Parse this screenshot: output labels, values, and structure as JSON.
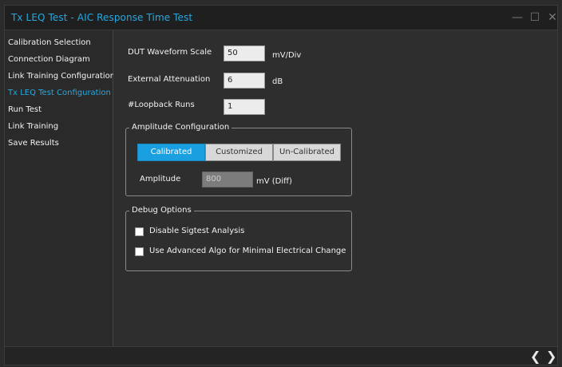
{
  "window": {
    "title": "Tx LEQ Test - AIC Response Time Test",
    "minimize_glyph": "—",
    "maximize_glyph": "☐",
    "close_glyph": "✕"
  },
  "sidebar": {
    "items": [
      {
        "label": "Calibration Selection",
        "active": false
      },
      {
        "label": "Connection Diagram",
        "active": false
      },
      {
        "label": "Link Training Configuration",
        "active": false
      },
      {
        "label": "Tx LEQ Test Configuration",
        "active": true
      },
      {
        "label": "Run Test",
        "active": false
      },
      {
        "label": "Link Training",
        "active": false
      },
      {
        "label": "Save Results",
        "active": false
      }
    ]
  },
  "form": {
    "dut_waveform_scale": {
      "label": "DUT Waveform Scale",
      "value": "50",
      "unit": "mV/Div"
    },
    "external_attenuation": {
      "label": "External Attenuation",
      "value": "6",
      "unit": "dB"
    },
    "loopback_runs": {
      "label": "#Loopback Runs",
      "value": "1"
    }
  },
  "amplitude_config": {
    "legend": "Amplitude Configuration",
    "options": [
      "Calibrated",
      "Customized",
      "Un-Calibrated"
    ],
    "selected": "Calibrated",
    "amplitude_label": "Amplitude",
    "amplitude_value": "800",
    "amplitude_unit": "mV (Diff)"
  },
  "debug_options": {
    "legend": "Debug Options",
    "disable_sigtest": {
      "label": "Disable Sigtest Analysis",
      "checked": false
    },
    "advanced_algo": {
      "label": "Use Advanced Algo for Minimal Electrical Change",
      "checked": false
    }
  },
  "footer": {
    "prev_glyph": "❮",
    "next_glyph": "❯"
  },
  "colors": {
    "accent": "#25a9e0",
    "selected_segment": "#1aa0e0",
    "background": "#2e2e2e"
  }
}
